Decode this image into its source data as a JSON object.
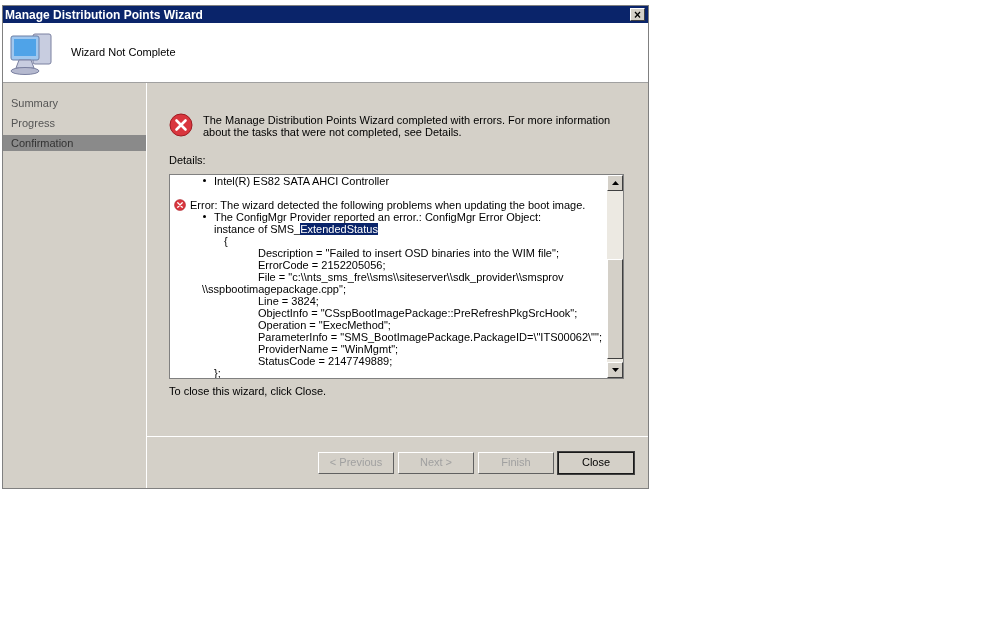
{
  "window": {
    "title": "Manage Distribution Points Wizard",
    "close": "×"
  },
  "header": {
    "title": "Wizard Not Complete"
  },
  "sidebar": {
    "items": [
      {
        "label": "Summary",
        "selected": false
      },
      {
        "label": "Progress",
        "selected": false
      },
      {
        "label": "Confirmation",
        "selected": true
      }
    ]
  },
  "message": "The Manage Distribution Points Wizard completed with errors. For more information about the tasks that were not completed, see Details.",
  "details": {
    "label": "Details:",
    "top_bullet": "Intel(R) ES82 SATA AHCI Controller",
    "error": "Error: The wizard detected the following problems when updating the boot image.",
    "bullet": "The ConfigMgr Provider reported an error.: ConfigMgr Error Object:",
    "instance_prefix": "instance of SMS_",
    "instance_selected": "ExtendedStatus",
    "open_brace": "{",
    "fields": [
      {
        "kind": "field",
        "text": "Description = \"Failed to insert OSD binaries into the WIM file\";"
      },
      {
        "kind": "field",
        "text": "ErrorCode = 2152205056;"
      },
      {
        "kind": "field",
        "text": "File = \"c:\\\\nts_sms_fre\\\\sms\\\\siteserver\\\\sdk_provider\\\\smsprov"
      },
      {
        "kind": "continuation",
        "text": "\\\\sspbootimagepackage.cpp\";"
      },
      {
        "kind": "field",
        "text": "Line = 3824;"
      },
      {
        "kind": "field",
        "text": "ObjectInfo = \"CSspBootImagePackage::PreRefreshPkgSrcHook\";"
      },
      {
        "kind": "field",
        "text": "Operation = \"ExecMethod\";"
      },
      {
        "kind": "field",
        "text": "ParameterInfo = \"SMS_BootImagePackage.PackageID=\\\"ITS00062\\\"\";"
      },
      {
        "kind": "field",
        "text": "ProviderName = \"WinMgmt\";"
      },
      {
        "kind": "field",
        "text": "StatusCode = 2147749889;"
      }
    ],
    "close_brace": "};"
  },
  "hint": "To close this wizard, click Close.",
  "buttons": [
    {
      "label": "< Previous",
      "disabled": true,
      "default": false
    },
    {
      "label": "Next >",
      "disabled": true,
      "default": false
    },
    {
      "label": "Finish",
      "disabled": true,
      "default": false
    },
    {
      "label": "Close",
      "disabled": false,
      "default": true
    }
  ]
}
